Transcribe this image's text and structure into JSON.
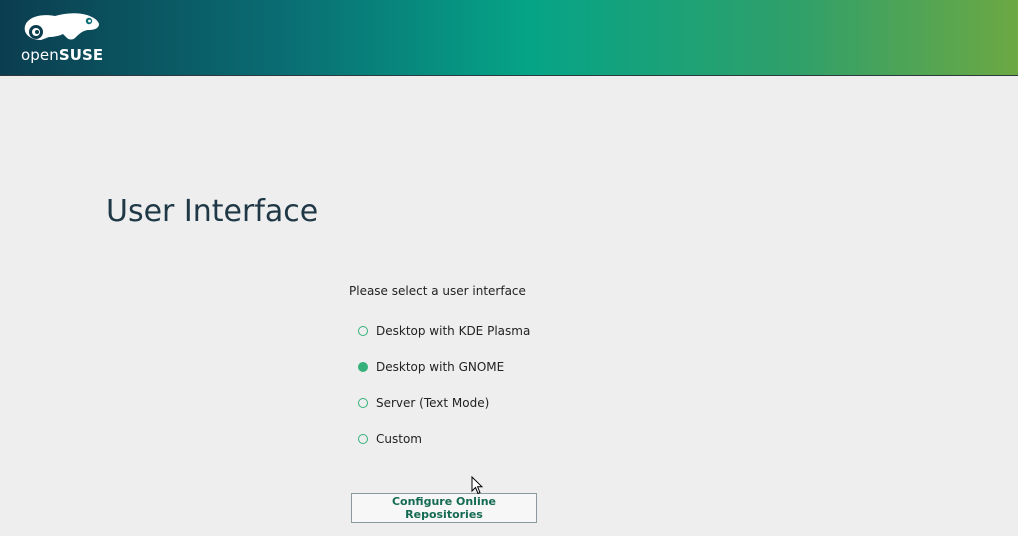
{
  "header": {
    "logo_text_light": "open",
    "logo_text_bold": "SUSE",
    "gradient_colors": [
      "#0b3d4f",
      "#05a487",
      "#6ca843"
    ]
  },
  "page": {
    "title": "User Interface"
  },
  "selection": {
    "prompt": "Please select a user interface",
    "options": [
      {
        "label": "Desktop with KDE Plasma",
        "selected": false
      },
      {
        "label": "Desktop with GNOME",
        "selected": true
      },
      {
        "label": "Server (Text Mode)",
        "selected": false
      },
      {
        "label": "Custom",
        "selected": false
      }
    ]
  },
  "buttons": {
    "configure_online_repositories": "Configure Online Repositories"
  },
  "colors": {
    "accent": "#35b07a",
    "title": "#1f3846",
    "button_text": "#146a52",
    "background": "#eeeeef"
  }
}
